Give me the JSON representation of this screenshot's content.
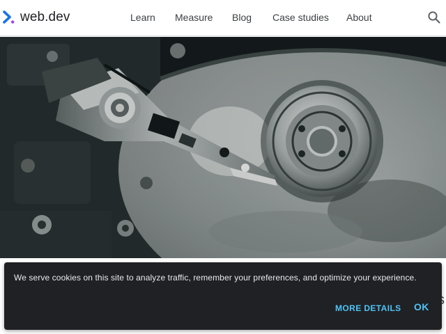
{
  "header": {
    "logo_text": "web.dev",
    "nav": [
      {
        "label": "Learn"
      },
      {
        "label": "Measure"
      },
      {
        "label": "Blog"
      },
      {
        "label": "Case studies"
      },
      {
        "label": "About"
      }
    ],
    "icons": {
      "logo": "web-dev-chevron-logo-icon",
      "search": "search-icon"
    }
  },
  "below_hero": {
    "peek_text": "s"
  },
  "cookie_banner": {
    "message": "We serve cookies on this site to analyze traffic, remember your preferences, and optimize your experience.",
    "more_details_label": "MORE DETAILS",
    "ok_label": "OK"
  },
  "colors": {
    "header_bg": "#ffffff",
    "nav_text": "#3c4043",
    "banner_bg": "#202124",
    "banner_text": "#e8eaed",
    "banner_button": "#4fc3f7",
    "logo_blue": "#1a73e8",
    "logo_purple": "#a142f4"
  }
}
